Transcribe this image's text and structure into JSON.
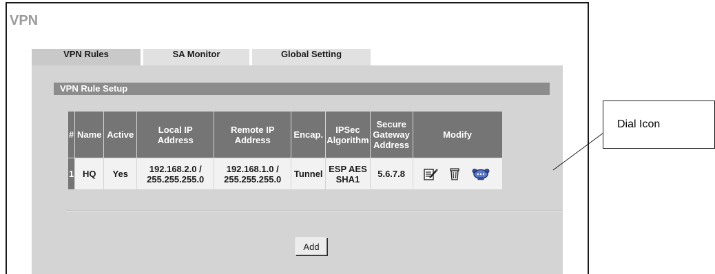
{
  "page_title": "VPN",
  "tabs": [
    {
      "label": "VPN Rules",
      "active": true
    },
    {
      "label": "SA Monitor",
      "active": false
    },
    {
      "label": "Global Setting",
      "active": false
    }
  ],
  "section_title": "VPN Rule Setup",
  "table": {
    "headers": {
      "num": "#",
      "name": "Name",
      "active": "Active",
      "local_1": "Local IP",
      "local_2": "Address",
      "remote_1": "Remote IP",
      "remote_2": "Address",
      "encap": "Encap.",
      "ipsec_1": "IPSec",
      "ipsec_2": "Algorithm",
      "gw_1": "Secure",
      "gw_2": "Gateway",
      "gw_3": "Address",
      "modify": "Modify"
    },
    "rows": [
      {
        "num": "1",
        "name": "HQ",
        "active": "Yes",
        "local_1": "192.168.2.0 /",
        "local_2": "255.255.255.0",
        "remote_1": "192.168.1.0 /",
        "remote_2": "255.255.255.0",
        "encap": "Tunnel",
        "ipsec_1": "ESP AES",
        "ipsec_2": "SHA1",
        "gateway": "5.6.7.8",
        "modify_icons": [
          "edit-icon",
          "trash-icon",
          "dial-icon"
        ]
      }
    ]
  },
  "add_button": "Add",
  "callout_label": "Dial Icon",
  "colors": {
    "header_bg": "#757575",
    "section_bar": "#8c8c8c",
    "panel_bg": "#d4d4d4",
    "active_tab": "#c9c9c9",
    "inactive_tab": "#e1e1e1",
    "title": "#9a9a9a"
  }
}
